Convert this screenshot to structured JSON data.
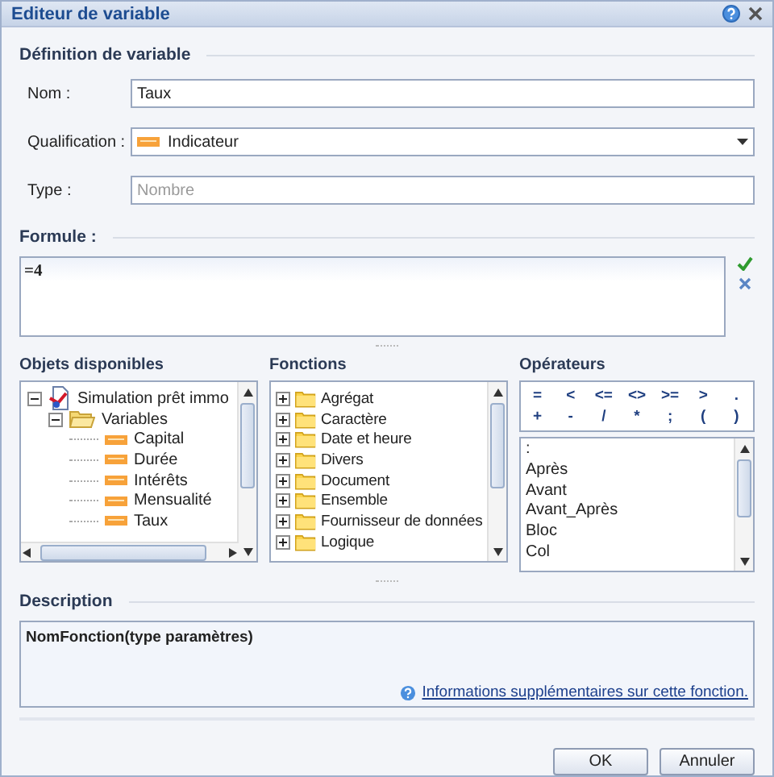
{
  "window": {
    "title": "Editeur de variable"
  },
  "definition": {
    "heading": "Définition de variable",
    "fields": [
      {
        "label": "Nom :",
        "kind": "text",
        "value": "Taux"
      },
      {
        "label": "Qualification :",
        "kind": "select",
        "value": "Indicateur"
      },
      {
        "label": "Type :",
        "kind": "readonly",
        "placeholder": "Nombre"
      }
    ]
  },
  "formula": {
    "heading": "Formule :",
    "value": "=4"
  },
  "objects": {
    "heading": "Objets disponibles",
    "tree": [
      {
        "label": "Simulation prêt immo",
        "kind": "document",
        "expanded": true,
        "children": [
          {
            "label": "Variables",
            "kind": "folder",
            "expanded": true,
            "children": [
              {
                "label": "Capital",
                "kind": "measure"
              },
              {
                "label": "Durée",
                "kind": "measure"
              },
              {
                "label": "Intérêts",
                "kind": "measure"
              },
              {
                "label": "Mensualité",
                "kind": "measure"
              },
              {
                "label": "Taux",
                "kind": "measure"
              }
            ]
          }
        ]
      }
    ]
  },
  "functions": {
    "heading": "Fonctions",
    "items": [
      {
        "label": "Agrégat",
        "expanded": false
      },
      {
        "label": "Caractère",
        "expanded": false
      },
      {
        "label": "Date et heure",
        "expanded": false
      },
      {
        "label": "Divers",
        "expanded": false
      },
      {
        "label": "Document",
        "expanded": false
      },
      {
        "label": "Ensemble",
        "expanded": false
      },
      {
        "label": "Fournisseur de données",
        "expanded": false
      },
      {
        "label": "Logique",
        "expanded": false
      }
    ]
  },
  "operators": {
    "heading": "Opérateurs",
    "buttons": [
      "=",
      "<",
      "<=",
      "<>",
      ">=",
      ">",
      ".",
      "+",
      "-",
      "/",
      "*",
      ";",
      "(",
      ")"
    ],
    "list": [
      ":",
      "Après",
      "Avant",
      "Avant_Après",
      "Bloc",
      "Col"
    ]
  },
  "description": {
    "heading": "Description",
    "signature": "NomFonction(type paramètres)",
    "link": "Informations supplémentaires sur cette fonction."
  },
  "buttons": [
    "OK",
    "Annuler"
  ]
}
